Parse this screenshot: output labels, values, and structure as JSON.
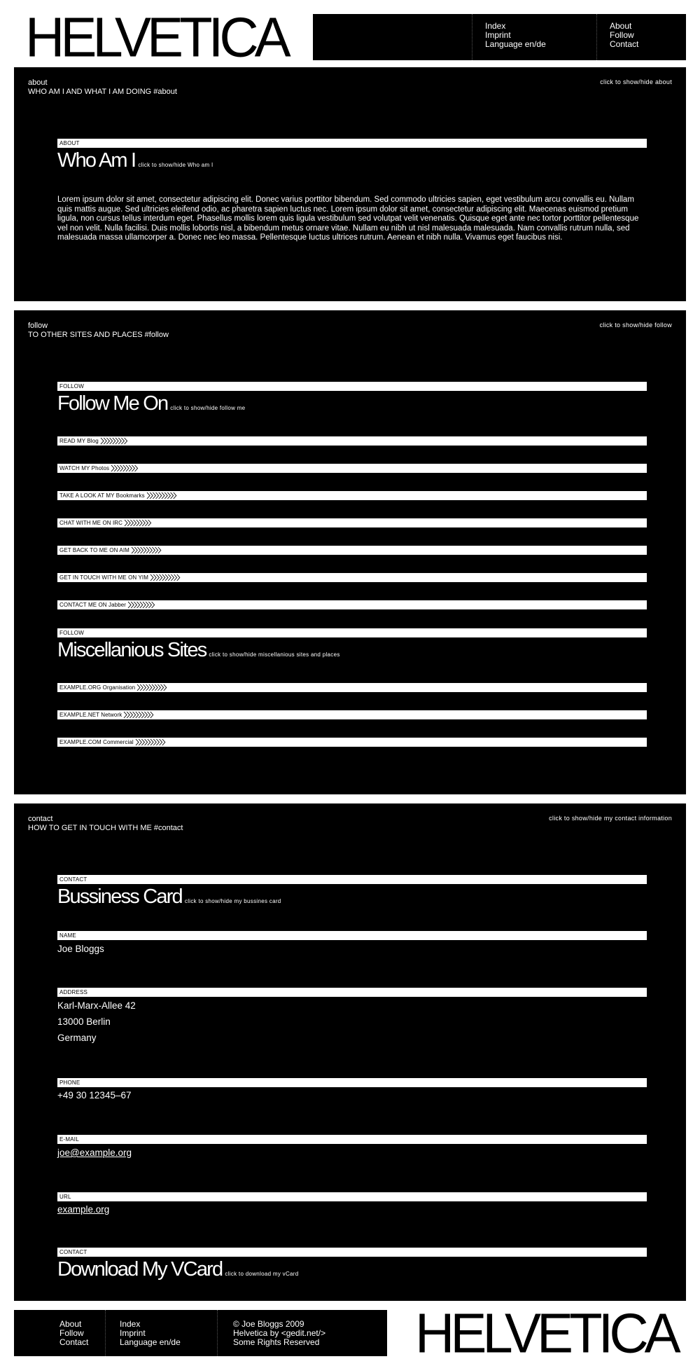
{
  "logo": "HELVETICA",
  "header_nav": {
    "col1": [
      "Index",
      "Imprint",
      "Language en/de"
    ],
    "col2": [
      "About",
      "Follow",
      "Contact"
    ]
  },
  "about": {
    "label": "about",
    "subtitle": "WHO AM I AND WHAT I AM DOING #about",
    "toggle": "click to show/hide about",
    "bar": "ABOUT",
    "title": "Who Am I",
    "title_toggle": "click to show/hide Who am I",
    "text": "Lorem ipsum dolor sit amet, consectetur adipiscing elit. Donec varius porttitor bibendum. Sed commodo ultricies sapien, eget vestibulum arcu convallis eu. Nullam quis mattis augue. Sed ultricies eleifend odio, ac pharetra sapien luctus nec. Lorem ipsum dolor sit amet, consectetur adipiscing elit. Maecenas euismod pretium ligula, non cursus tellus interdum eget. Phasellus mollis lorem quis ligula vestibulum sed volutpat velit venenatis. Quisque eget ante nec tortor porttitor pellentesque vel non velit. Nulla facilisi. Duis mollis lobortis nisl, a bibendum metus ornare vitae. Nullam eu nibh ut nisl malesuada malesuada. Nam convallis rutrum nulla, sed malesuada massa ullamcorper a. Donec nec leo massa. Pellentesque luctus ultrices rutrum. Aenean et nibh nulla. Vivamus eget faucibus nisi."
  },
  "follow": {
    "label": "follow",
    "subtitle": "TO OTHER SITES AND PLACES #follow",
    "toggle": "click to show/hide follow",
    "bar1": "FOLLOW",
    "title1": "Follow Me On",
    "title1_toggle": "click to show/hide follow me",
    "links": [
      {
        "label": "READ MY Blog",
        "chevrons": 9
      },
      {
        "label": "WATCH MY Photos",
        "chevrons": 9
      },
      {
        "label": "TAKE A LOOK AT MY Bookmarks",
        "chevrons": 10
      },
      {
        "label": "CHAT WITH ME ON IRC",
        "chevrons": 9
      },
      {
        "label": "GET BACK TO ME ON AIM",
        "chevrons": 10
      },
      {
        "label": "GET IN TOUCH WITH ME ON YIM",
        "chevrons": 10
      },
      {
        "label": "CONTACT ME ON Jabber",
        "chevrons": 9
      }
    ],
    "bar2": "FOLLOW",
    "title2": "Miscellanious Sites",
    "title2_toggle": "click to show/hide miscellanious sites and places",
    "misc_links": [
      {
        "label": "EXAMPLE.ORG Organisation",
        "chevrons": 10
      },
      {
        "label": "EXAMPLE.NET Network",
        "chevrons": 10
      },
      {
        "label": "EXAMPLE.COM Commercial",
        "chevrons": 10
      }
    ]
  },
  "contact": {
    "label": "contact",
    "subtitle": "HOW TO GET IN TOUCH WITH ME #contact",
    "toggle": "click to show/hide my contact information",
    "bar": "CONTACT",
    "title": "Bussiness Card",
    "title_toggle": "click to show/hide my bussines card",
    "name_label": "NAME",
    "name": "Joe Bloggs",
    "address_label": "ADDRESS",
    "address": [
      "Karl-Marx-Allee 42",
      "13000 Berlin",
      "Germany"
    ],
    "phone_label": "PHONE",
    "phone": "+49 30 12345–67",
    "email_label": "E-MAIL",
    "email": "joe@example.org",
    "url_label": "URL",
    "url": "example.org",
    "vcard_bar": "CONTACT",
    "vcard_title": "Download My VCard",
    "vcard_toggle": "click to download my vCard"
  },
  "footer": {
    "col1": [
      "About",
      "Follow",
      "Contact"
    ],
    "col2": [
      "Index",
      "Imprint",
      "Language en/de"
    ],
    "col3": [
      "© Joe Bloggs 2009",
      "Helvetica by <gedit.net/>",
      "Some Rights Reserved"
    ]
  }
}
